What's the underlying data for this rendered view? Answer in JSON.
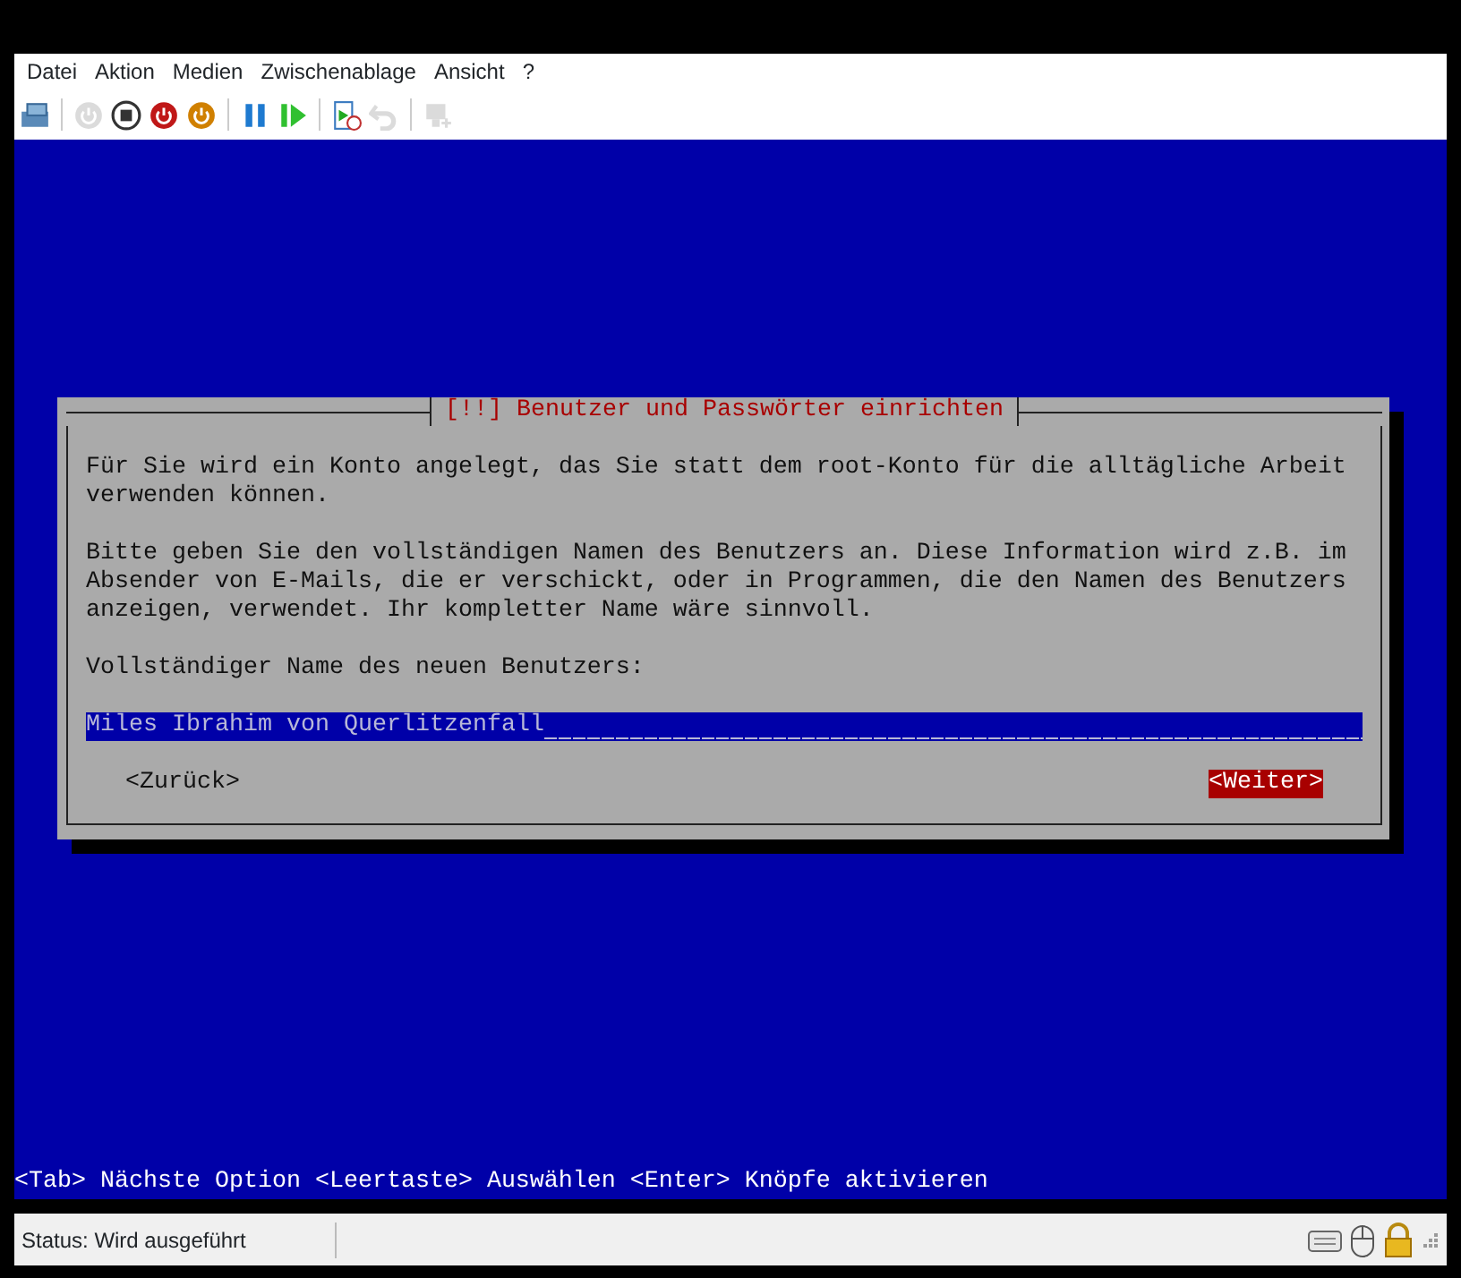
{
  "menu": [
    {
      "label": "Datei"
    },
    {
      "label": "Aktion"
    },
    {
      "label": "Medien"
    },
    {
      "label": "Zwischenablage"
    },
    {
      "label": "Ansicht"
    },
    {
      "label": "?"
    }
  ],
  "toolbar": [
    {
      "kind": "ctrl-alt-del",
      "disabled": false
    },
    {
      "kind": "sep"
    },
    {
      "kind": "power",
      "disabled": true
    },
    {
      "kind": "stop",
      "disabled": false
    },
    {
      "kind": "shutdown",
      "disabled": false
    },
    {
      "kind": "save",
      "disabled": false
    },
    {
      "kind": "sep"
    },
    {
      "kind": "pause",
      "disabled": false
    },
    {
      "kind": "reset",
      "disabled": false
    },
    {
      "kind": "sep"
    },
    {
      "kind": "checkpoint",
      "disabled": false
    },
    {
      "kind": "revert",
      "disabled": true
    },
    {
      "kind": "sep"
    },
    {
      "kind": "enhanced",
      "disabled": true
    }
  ],
  "dialog": {
    "title": "[!!] Benutzer und Passwörter einrichten",
    "paragraphs": [
      "Für Sie wird ein Konto angelegt, das Sie statt dem root-Konto für die alltägliche Arbeit verwenden können.",
      "Bitte geben Sie den vollständigen Namen des Benutzers an. Diese Information wird z.B. im Absender von E-Mails, die er verschickt, oder in Programmen, die den Namen des Benutzers anzeigen, verwendet. Ihr kompletter Name wäre sinnvoll."
    ],
    "field_label": "Vollständiger Name des neuen Benutzers:",
    "field_value": "Miles Ibrahim von Querlitzenfall",
    "buttons": [
      {
        "label": "<Zurück>",
        "selected": false
      },
      {
        "label": "<Weiter>",
        "selected": true
      }
    ]
  },
  "hint": "<Tab> Nächste Option <Leertaste> Auswählen <Enter> Knöpfe aktivieren",
  "status_bar": {
    "text": "Status: Wird ausgeführt"
  }
}
